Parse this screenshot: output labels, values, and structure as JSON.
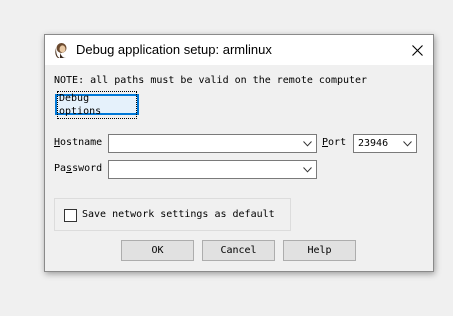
{
  "window": {
    "title": "Debug application setup: armlinux",
    "icon": "app-icon",
    "close_icon": "close-icon"
  },
  "note": "NOTE: all paths must be valid on the remote computer",
  "debug_options_label": "Debug options",
  "hostname": {
    "label_prefix": "H",
    "label_rest": "ostname",
    "value": ""
  },
  "port": {
    "label_prefix": "P",
    "label_rest": "ort",
    "value": "23946"
  },
  "password": {
    "label_prefix": "Pa",
    "label_underlined": "s",
    "label_rest": "sword",
    "value": ""
  },
  "save_settings": {
    "label": "Save network settings as default",
    "checked": false
  },
  "buttons": {
    "ok": "OK",
    "cancel": "Cancel",
    "help": "Help"
  },
  "colors": {
    "accent": "#0078d7",
    "button_face": "#e1e1e1",
    "dialog_bg": "#f0f0f0"
  }
}
